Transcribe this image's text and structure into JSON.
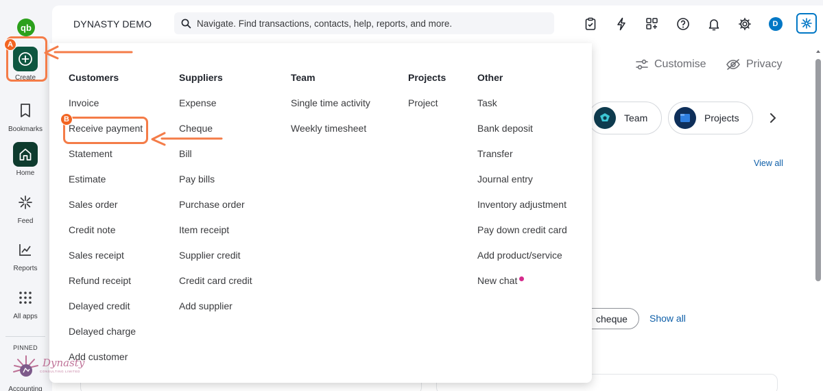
{
  "app": {
    "company_name": "DYNASTY DEMO",
    "logo_text": "qb",
    "avatar_initial": "D"
  },
  "search": {
    "placeholder": "Navigate. Find transactions, contacts, help, reports, and more."
  },
  "header_icons": [
    "clipboard-icon",
    "bolt-icon",
    "apps-switch-icon",
    "help-icon",
    "bell-icon",
    "gear-icon",
    "avatar",
    "assistant-icon"
  ],
  "rail": {
    "create_label": "Create",
    "items": [
      {
        "label": "Bookmarks",
        "icon": "bookmark-icon"
      },
      {
        "label": "Home",
        "icon": "home-icon",
        "active": true
      },
      {
        "label": "Feed",
        "icon": "feed-icon"
      },
      {
        "label": "Reports",
        "icon": "reports-icon"
      },
      {
        "label": "All apps",
        "icon": "grid-icon"
      }
    ],
    "pinned_label": "PINNED",
    "accounting_label": "Accounting"
  },
  "main": {
    "customise_label": "Customise",
    "privacy_label": "Privacy",
    "pills": [
      {
        "label": "Team",
        "icon": "team-icon"
      },
      {
        "label": "Projects",
        "icon": "projects-icon"
      }
    ],
    "view_all_label": "View all",
    "cheque_label": "cheque",
    "show_all_label": "Show all"
  },
  "dropdown": {
    "columns": [
      {
        "heading": "Customers",
        "items": [
          "Invoice",
          "Receive payment",
          "Statement",
          "Estimate",
          "Sales order",
          "Credit note",
          "Sales receipt",
          "Refund receipt",
          "Delayed credit",
          "Delayed charge",
          "Add customer"
        ]
      },
      {
        "heading": "Suppliers",
        "items": [
          "Expense",
          "Cheque",
          "Bill",
          "Pay bills",
          "Purchase order",
          "Item receipt",
          "Supplier credit",
          "Credit card credit",
          "Add supplier"
        ]
      },
      {
        "heading": "Team",
        "items": [
          "Single time activity",
          "Weekly timesheet"
        ]
      },
      {
        "heading": "Projects",
        "items": [
          "Project"
        ]
      },
      {
        "heading": "Other",
        "items": [
          "Task",
          "Bank deposit",
          "Transfer",
          "Journal entry",
          "Inventory adjustment",
          "Pay down credit card",
          "Add product/service",
          "New chat"
        ]
      }
    ]
  },
  "annotations": {
    "badge_a": "A",
    "badge_b": "B",
    "color": "#f47c48"
  },
  "watermark": {
    "text": "Dynasty",
    "sub": "CONSULTING LIMITED"
  },
  "colors": {
    "brand_green": "#2ca01c",
    "create_green": "#0e5640",
    "link_blue": "#0d5ea8",
    "new_dot": "#d52b8c"
  }
}
